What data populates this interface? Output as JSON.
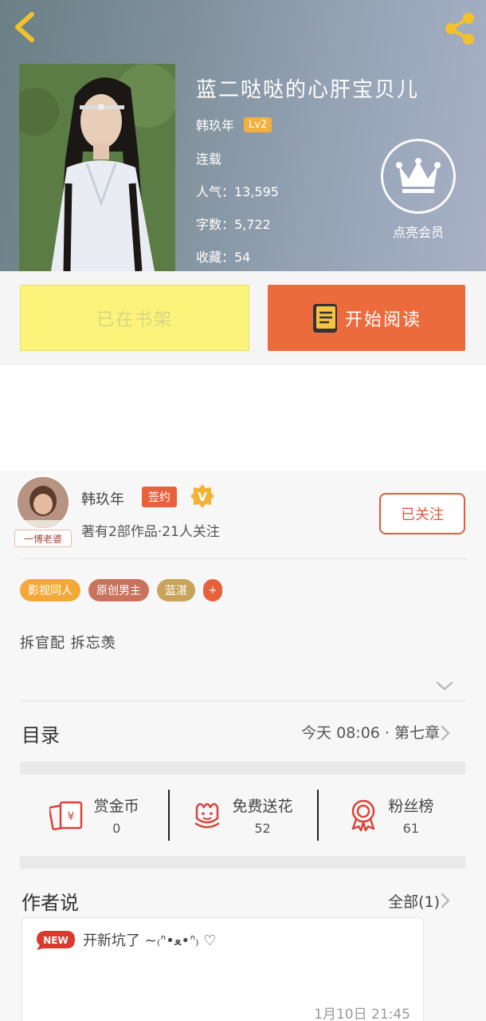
{
  "header": {
    "book_title": "蓝二哒哒的心肝宝贝儿",
    "author": "韩玖年",
    "level": "Lv2",
    "status": "连载",
    "popularity": "人气：13,595",
    "word_count": "字数：5,722",
    "favorites": "收藏：54",
    "vip_label": "点亮会员"
  },
  "actions": {
    "shelf_label": "已在书架",
    "read_label": "开始阅读"
  },
  "author_card": {
    "name": "韩玖年",
    "signed_badge": "签约",
    "v_badge": "V",
    "stats": "著有2部作品·21人关注",
    "avatar_tag": "一博老婆",
    "follow_label": "已关注"
  },
  "tags": [
    {
      "label": "影视同人",
      "color": "#f3a93a"
    },
    {
      "label": "原创男主",
      "color": "#c9725d"
    },
    {
      "label": "蓝湛",
      "color": "#c9a35a"
    }
  ],
  "tag_more": "+",
  "description": "拆官配  拆忘羡",
  "toc": {
    "title": "目录",
    "latest": "今天 08:06 · 第七章"
  },
  "stats": [
    {
      "label": "赏金币",
      "value": "0",
      "icon": "red-envelope-icon"
    },
    {
      "label": "免费送花",
      "value": "52",
      "icon": "flower-icon"
    },
    {
      "label": "粉丝榜",
      "value": "61",
      "icon": "medal-icon"
    }
  ],
  "author_says": {
    "title": "作者说",
    "all_label": "全部(1)",
    "new_badge": "NEW",
    "note": "开新坑了 ~₍ᐢ•ﻌ•ᐢ₎ ♡",
    "time": "1月10日  21:45"
  },
  "colors": {
    "accent": "#ec6b3c",
    "shelf_yellow": "#fbf37a",
    "follow_red": "#e35a3b"
  }
}
